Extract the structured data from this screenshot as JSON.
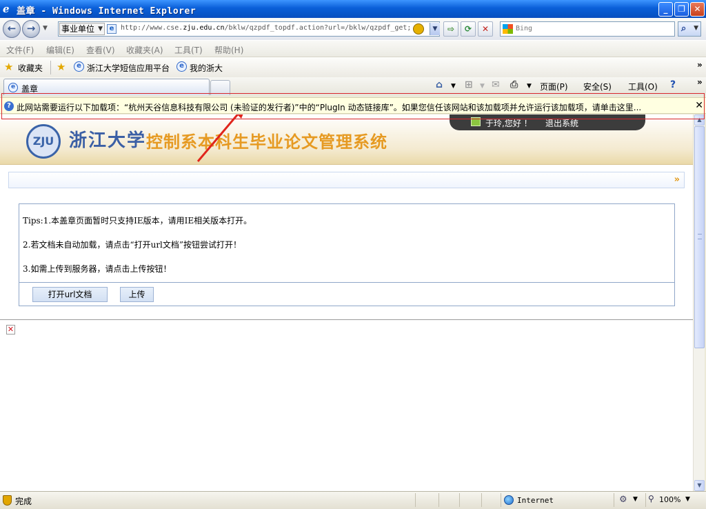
{
  "window": {
    "title": "盖章 - Windows Internet Explorer",
    "minimize": "_",
    "restore": "❐",
    "close": "✕"
  },
  "address": {
    "org_label": "事业单位",
    "url_prefix": "http://www.cse.",
    "url_domain": "zju.edu.cn",
    "url_suffix": "/bklw/qzpdf_topdf.action?url=/bklw/qzpdf_get;",
    "search_placeholder": "Bing"
  },
  "menu": [
    "文件(F)",
    "编辑(E)",
    "查看(V)",
    "收藏夹(A)",
    "工具(T)",
    "帮助(H)"
  ],
  "favorites": {
    "favorites_label": "收藏夹",
    "items": [
      "浙江大学短信应用平台",
      "我的浙大"
    ],
    "overflow": "»"
  },
  "tab": {
    "title": "盖章"
  },
  "commands": {
    "page": "页面(P)",
    "safety": "安全(S)",
    "tools": "工具(O)"
  },
  "infobar": {
    "message": "此网站需要运行以下加载项：“杭州天谷信息科技有限公司 (未验证的发行者)”中的“PlugIn 动态链接库”。如果您信任该网站和该加载项并允许运行该加载项，请单击这里...",
    "close": "✕"
  },
  "site": {
    "title_zju": "浙江大学",
    "title_system": "控制系本科生毕业论文管理系统",
    "greeting": "于玲,您好 ！",
    "logout": "退出系统",
    "tips": [
      "Tips:1.本盖章页面暂时只支持IE版本，请用IE相关版本打开。",
      "2.若文档未自动加载，请点击“打开url文档”按钮尝试打开！",
      "3.如需上传到服务器，请点击上传按钮！"
    ],
    "open_url_button": "打开url文档",
    "upload_button": "上传"
  },
  "status": {
    "text": "完成",
    "zone": "Internet",
    "zoom": "100%"
  },
  "colors": {
    "titlebar": "#0a5fd8",
    "annotation": "#d8262b",
    "infobar_bg": "#ffffe1",
    "site_title_blue": "#3b5fa5",
    "site_title_orange": "#e69a22"
  }
}
